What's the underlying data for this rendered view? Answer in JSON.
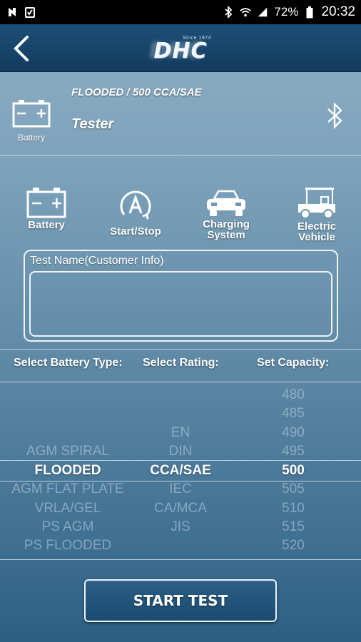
{
  "status_bar": {
    "battery_percent": "72%",
    "time": "20:32",
    "left_icons": [
      "media-icon",
      "clipboard-check-icon"
    ],
    "right_icons": [
      "bluetooth-icon",
      "wifi-icon",
      "signal-icon",
      "battery-icon"
    ]
  },
  "header": {
    "logo_since": "Since 1974",
    "logo_text": "DHC"
  },
  "current_test": {
    "title": "FLOODED / 500 CCA/SAE",
    "subtitle": "Tester",
    "icon_label": "Battery"
  },
  "test_types": [
    {
      "label": "Battery",
      "icon": "battery-icon"
    },
    {
      "label": "Start/Stop",
      "icon": "auto-start-stop-icon"
    },
    {
      "label": "Charging System",
      "icon": "car-icon"
    },
    {
      "label": "Electric Vehicle",
      "icon": "golf-cart-icon"
    }
  ],
  "test_name": {
    "label": "Test Name(Customer Info)",
    "value": ""
  },
  "selection": {
    "battery_type_header": "Select Battery Type:",
    "rating_header": "Select Rating:",
    "capacity_header": "Set Capacity:",
    "battery_types": [
      "AGM SPIRAL",
      "FLOODED",
      "AGM FLAT PLATE",
      "VRLA/GEL",
      "PS AGM",
      "PS FLOODED"
    ],
    "ratings": [
      "EN",
      "DIN",
      "CCA/SAE",
      "IEC",
      "CA/MCA",
      "JIS"
    ],
    "capacities": [
      "480",
      "485",
      "490",
      "495",
      "500",
      "505",
      "510",
      "515",
      "520"
    ],
    "selected_battery_type": "FLOODED",
    "selected_rating": "CCA/SAE",
    "selected_capacity": "500"
  },
  "actions": {
    "start_label": "START TEST"
  }
}
